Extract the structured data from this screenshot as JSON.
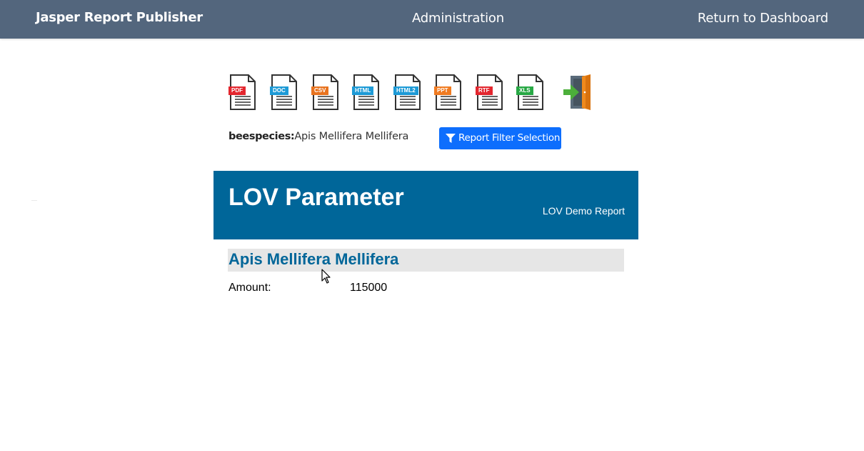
{
  "navbar": {
    "brand": "Jasper Report Publisher",
    "admin_label": "Administration",
    "return_label": "Return to Dashboard"
  },
  "exports": [
    {
      "label": "PDF",
      "color": "#e3262e"
    },
    {
      "label": "DOC",
      "color": "#1d9ad6"
    },
    {
      "label": "CSV",
      "color": "#e8731f"
    },
    {
      "label": "HTML",
      "color": "#1d9ad6"
    },
    {
      "label": "HTML2",
      "color": "#1d9ad6"
    },
    {
      "label": "PPT",
      "color": "#f07b21"
    },
    {
      "label": "RTF",
      "color": "#e3262e"
    },
    {
      "label": "XLS",
      "color": "#27a844"
    }
  ],
  "parameter": {
    "name": "beespecies:",
    "value": "Apis Mellifera Mellifera"
  },
  "filter_button": {
    "label": "Report Filter Selection"
  },
  "report": {
    "title": "LOV Parameter",
    "subtitle": "LOV Demo Report",
    "group_title": "Apis Mellifera Mellifera",
    "amount_label": "Amount:",
    "amount_value": "115000"
  },
  "colors": {
    "navbar": "#53667d",
    "primary_button": "#0d6efd",
    "report_header": "#006699",
    "group_band": "#e6e6e6"
  }
}
